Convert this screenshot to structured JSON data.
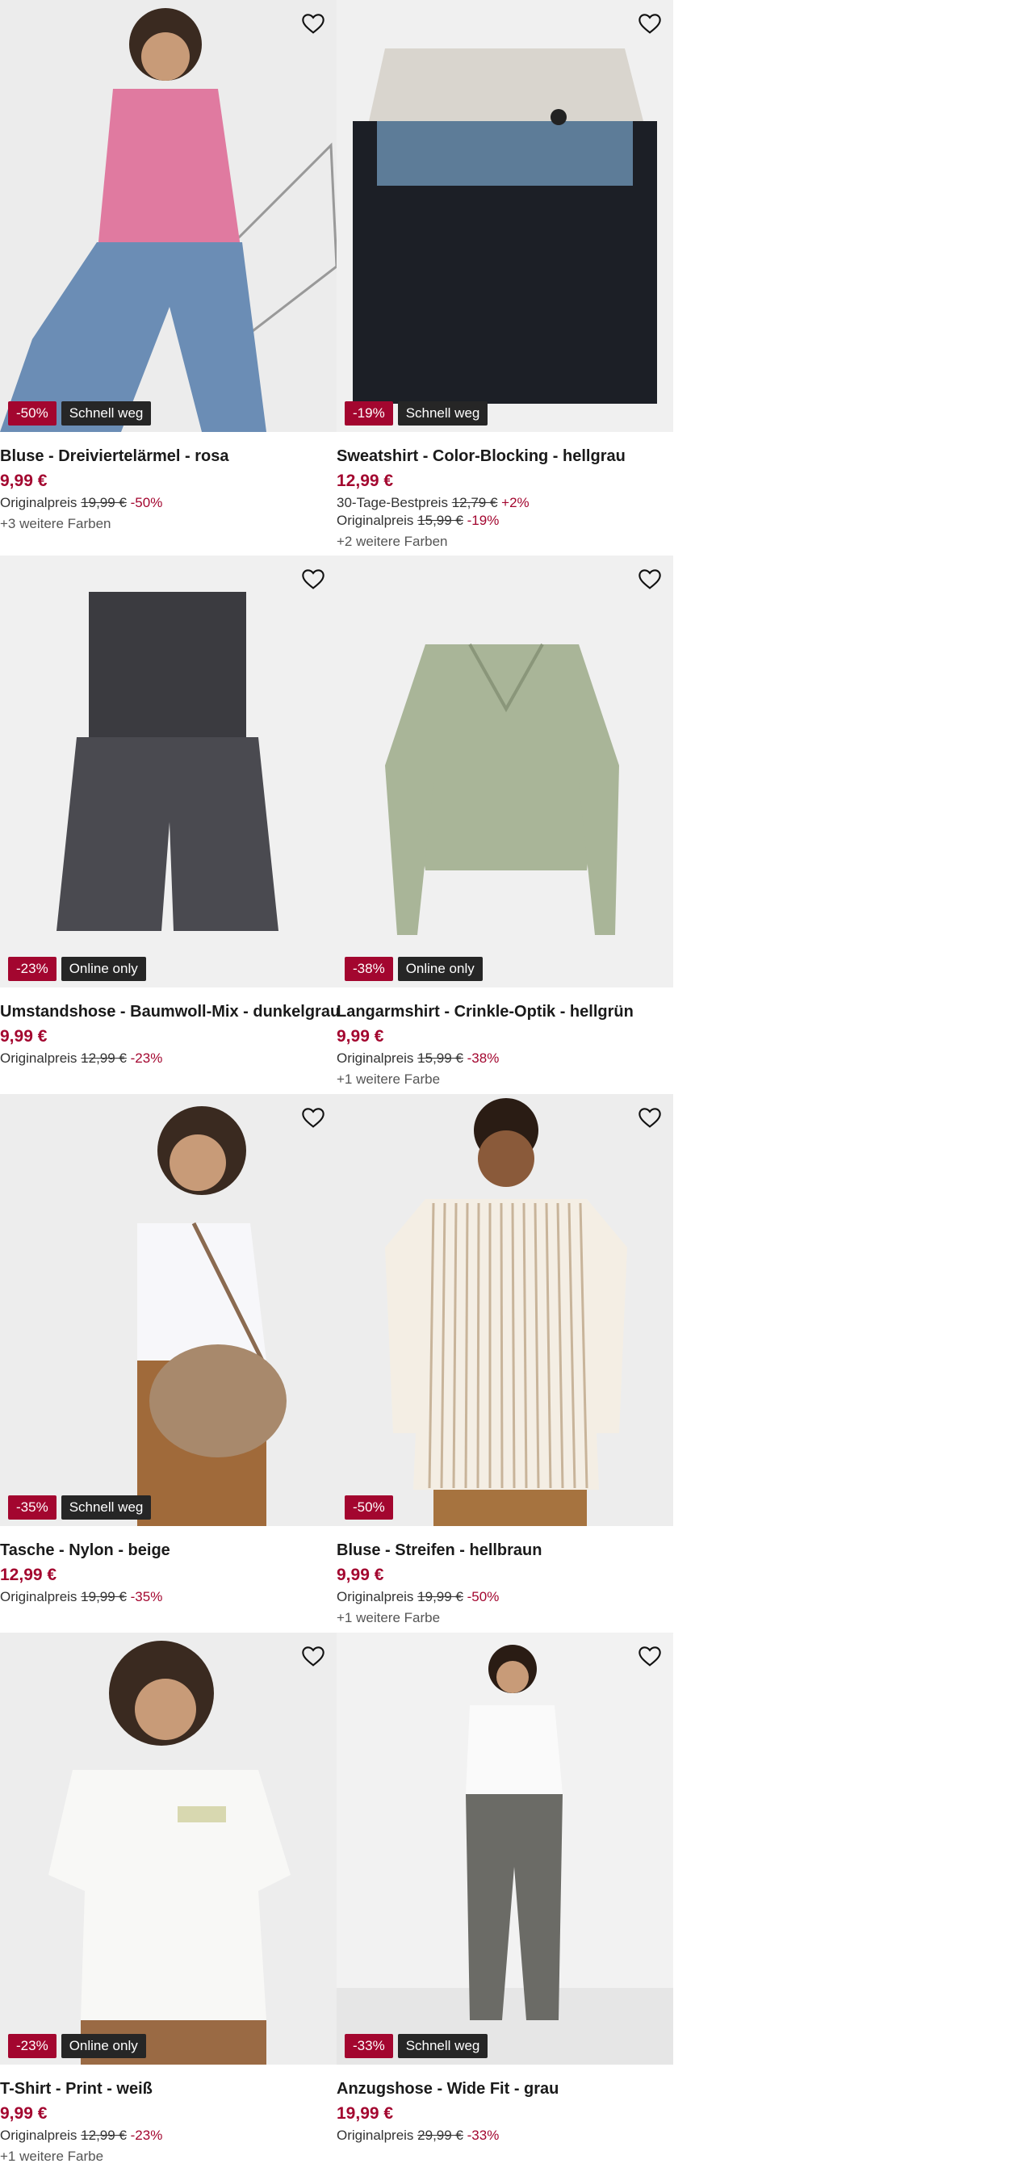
{
  "products": [
    {
      "title": "Bluse - Dreiviertelärmel - rosa",
      "price": "9,99 €",
      "lines": [
        {
          "label": "Originalpreis",
          "old": "19,99 €",
          "pct": "-50%"
        }
      ],
      "colors": "+3 weitere Farben",
      "badge_sale": "-50%",
      "badge_info": "Schnell weg",
      "image": "pink striped blouse model",
      "accent": "#e07aa0"
    },
    {
      "title": "Sweatshirt - Color-Blocking - hellgrau",
      "price": "12,99 €",
      "lines": [
        {
          "label": "30-Tage-Bestpreis",
          "old": "12,79 €",
          "pct": "+2%"
        },
        {
          "label": "Originalpreis",
          "old": "15,99 €",
          "pct": "-19%"
        }
      ],
      "colors": "+2 weitere Farben",
      "badge_sale": "-19%",
      "badge_info": "Schnell weg",
      "image": "color block sweatshirt",
      "accent": "#5d7c98"
    },
    {
      "title": "Umstandshose - Baumwoll-Mix - dunkelgrau",
      "price": "9,99 €",
      "lines": [
        {
          "label": "Originalpreis",
          "old": "12,99 €",
          "pct": "-23%"
        }
      ],
      "colors": "",
      "badge_sale": "-23%",
      "badge_info": "Online only",
      "image": "dark grey maternity shorts",
      "accent": "#3b3b40"
    },
    {
      "title": "Langarmshirt - Crinkle-Optik - hellgrün",
      "price": "9,99 €",
      "lines": [
        {
          "label": "Originalpreis",
          "old": "15,99 €",
          "pct": "-38%"
        }
      ],
      "colors": "+1 weitere Farbe",
      "badge_sale": "-38%",
      "badge_info": "Online only",
      "image": "light green wrap top",
      "accent": "#a9b598"
    },
    {
      "title": "Tasche - Nylon - beige",
      "price": "12,99 €",
      "lines": [
        {
          "label": "Originalpreis",
          "old": "19,99 €",
          "pct": "-35%"
        }
      ],
      "colors": "",
      "badge_sale": "-35%",
      "badge_info": "Schnell weg",
      "image": "beige nylon bag model",
      "accent": "#a8896c"
    },
    {
      "title": "Bluse - Streifen - hellbraun",
      "price": "9,99 €",
      "lines": [
        {
          "label": "Originalpreis",
          "old": "19,99 €",
          "pct": "-50%"
        }
      ],
      "colors": "+1 weitere Farbe",
      "badge_sale": "-50%",
      "badge_info": "",
      "image": "striped blouse model",
      "accent": "#c8b49a"
    },
    {
      "title": "T-Shirt - Print - weiß",
      "price": "9,99 €",
      "lines": [
        {
          "label": "Originalpreis",
          "old": "12,99 €",
          "pct": "-23%"
        }
      ],
      "colors": "+1 weitere Farbe",
      "badge_sale": "-23%",
      "badge_info": "Online only",
      "image": "white print t-shirt model",
      "accent": "#9a6a44"
    },
    {
      "title": "Anzugshose - Wide Fit - grau",
      "price": "19,99 €",
      "lines": [
        {
          "label": "Originalpreis",
          "old": "29,99 €",
          "pct": "-33%"
        }
      ],
      "colors": "",
      "badge_sale": "-33%",
      "badge_info": "Schnell weg",
      "image": "grey wide fit trousers model",
      "accent": "#6b6b66"
    }
  ],
  "icons": {
    "wishlist": "heart-outline-icon"
  }
}
